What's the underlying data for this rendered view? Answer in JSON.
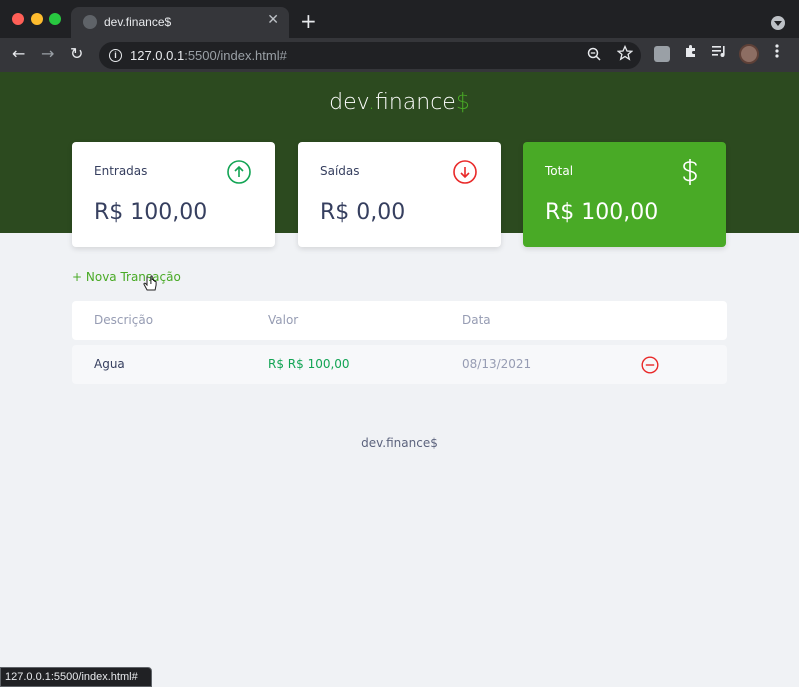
{
  "browser": {
    "tab_title": "dev.finance$",
    "close_glyph": "✕",
    "new_tab_glyph": "+",
    "back_glyph": "←",
    "forward_glyph": "→",
    "reload_glyph": "↻",
    "info_glyph": "i",
    "url_host": "127.0.0.1",
    "url_rest": ":5500/index.html#",
    "status_url": "127.0.0.1:5500/index.html#"
  },
  "header": {
    "logo_dev": "dev",
    "logo_dot": ".",
    "logo_finance": "finance",
    "logo_dollar": "$"
  },
  "cards": {
    "income": {
      "label": "Entradas",
      "value": "R$ 100,00",
      "icon": "income-arrow-up-icon"
    },
    "expense": {
      "label": "Saídas",
      "value": "R$ 0,00",
      "icon": "expense-arrow-down-icon"
    },
    "total": {
      "label": "Total",
      "value": "R$ 100,00",
      "icon": "dollar-icon"
    }
  },
  "actions": {
    "new_transaction": "+ Nova Transação"
  },
  "table": {
    "headers": {
      "description": "Descrição",
      "amount": "Valor",
      "date": "Data"
    },
    "rows": [
      {
        "description": "Agua",
        "amount": "R$ R$ 100,00",
        "date": "08/13/2021"
      }
    ]
  },
  "footer": {
    "text": "dev.finance$"
  },
  "colors": {
    "header_bg": "#2c4a1f",
    "brand_green": "#49aa26",
    "income_green": "#12a454",
    "expense_red": "#e92929",
    "text_dark": "#363f5f",
    "text_muted": "#969cb3"
  }
}
